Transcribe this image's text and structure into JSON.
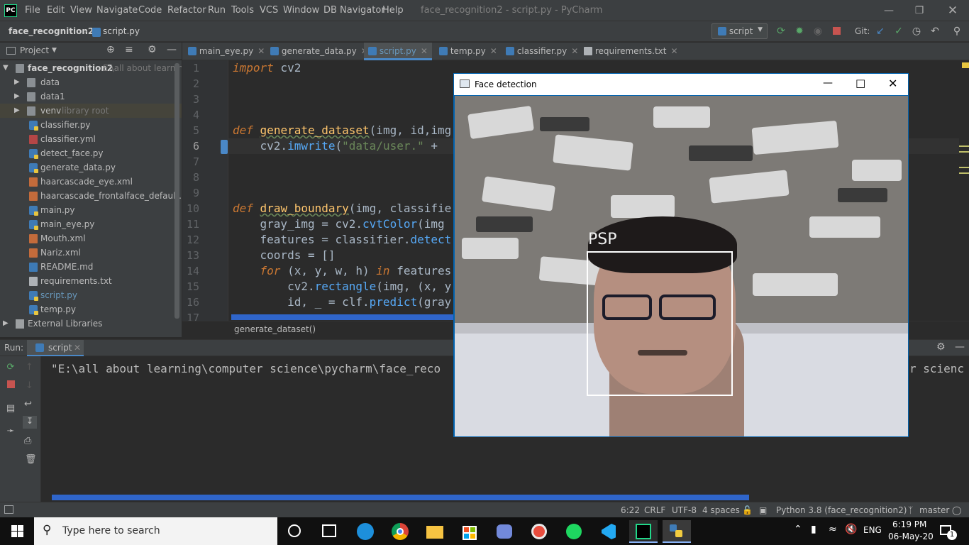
{
  "window": {
    "title": "face_recognition2 - script.py - PyCharm",
    "logo": "PC"
  },
  "menu": [
    "File",
    "Edit",
    "View",
    "Navigate",
    "Code",
    "Refactor",
    "Run",
    "Tools",
    "VCS",
    "Window",
    "DB Navigator",
    "Help"
  ],
  "breadcrumb": {
    "project": "face_recognition2",
    "file": "script.py"
  },
  "toolbar": {
    "run_config": "script",
    "git_label": "Git:"
  },
  "project_panel": {
    "title": "Project",
    "root": {
      "name": "face_recognition2",
      "path": "E:\\all about learning"
    },
    "items": [
      {
        "name": "data",
        "type": "folder"
      },
      {
        "name": "data1",
        "type": "folder"
      },
      {
        "name": "venv",
        "type": "folder",
        "note": "library root"
      },
      {
        "name": "classifier.py",
        "type": "py"
      },
      {
        "name": "classifier.yml",
        "type": "yml"
      },
      {
        "name": "detect_face.py",
        "type": "py"
      },
      {
        "name": "generate_data.py",
        "type": "py"
      },
      {
        "name": "haarcascade_eye.xml",
        "type": "xml"
      },
      {
        "name": "haarcascade_frontalface_default.xml",
        "type": "xml"
      },
      {
        "name": "main.py",
        "type": "py"
      },
      {
        "name": "main_eye.py",
        "type": "py"
      },
      {
        "name": "Mouth.xml",
        "type": "xml"
      },
      {
        "name": "Nariz.xml",
        "type": "xml"
      },
      {
        "name": "README.md",
        "type": "md"
      },
      {
        "name": "requirements.txt",
        "type": "txt"
      },
      {
        "name": "script.py",
        "type": "py",
        "active": true
      },
      {
        "name": "temp.py",
        "type": "py"
      }
    ],
    "external": "External Libraries"
  },
  "tabs": [
    {
      "label": "main_eye.py"
    },
    {
      "label": "generate_data.py"
    },
    {
      "label": "script.py",
      "active": true
    },
    {
      "label": "temp.py"
    },
    {
      "label": "classifier.py"
    },
    {
      "label": "requirements.txt"
    }
  ],
  "editor": {
    "line_numbers": [
      "1",
      "2",
      "3",
      "4",
      "5",
      "6",
      "7",
      "8",
      "9",
      "10",
      "11",
      "12",
      "13",
      "14",
      "15",
      "16",
      "17"
    ],
    "code": {
      "l1a": "import",
      "l1b": " cv2",
      "l5a": "def",
      "l5b": " ",
      "l5c": "generate_dataset",
      "l5d": "(img, id,img",
      "l6a": "    cv2.",
      "l6b": "imwrite",
      "l6c": "(",
      "l6d": "\"data/user.\"",
      "l6e": " + ",
      "l10a": "def",
      "l10b": " ",
      "l10c": "draw_boundary",
      "l10d": "(img, classifie",
      "l11a": "    gray_img = cv2.",
      "l11b": "cvtColor",
      "l11c": "(img",
      "l12a": "    features = classifier.",
      "l12b": "detect",
      "l13a": "    coords = []",
      "l14a": "    ",
      "l14b": "for",
      "l14c": " (x, y, w, h) ",
      "l14d": "in",
      "l14e": " features",
      "l15a": "        cv2.",
      "l15b": "rectangle",
      "l15c": "(img, (x, y",
      "l16a": "        id, _ = clf.",
      "l16b": "predict",
      "l16c": "(gray"
    },
    "breadcrumb": "generate_dataset()"
  },
  "run_panel": {
    "label": "Run:",
    "tab": "script",
    "output_left": "\"E:\\all about learning\\computer science\\pycharm\\face_reco",
    "output_right": "r scienc"
  },
  "popup": {
    "title": "Face detection",
    "label": "PSP"
  },
  "status": {
    "position": "6:22",
    "line_sep": "CRLF",
    "encoding": "UTF-8",
    "indent": "4 spaces",
    "interpreter": "Python 3.8 (face_recognition2)",
    "branch": "master"
  },
  "taskbar": {
    "search_placeholder": "Type here to search",
    "lang": "ENG",
    "time": "6:19 PM",
    "date": "06-May-20",
    "notif_count": "1"
  }
}
